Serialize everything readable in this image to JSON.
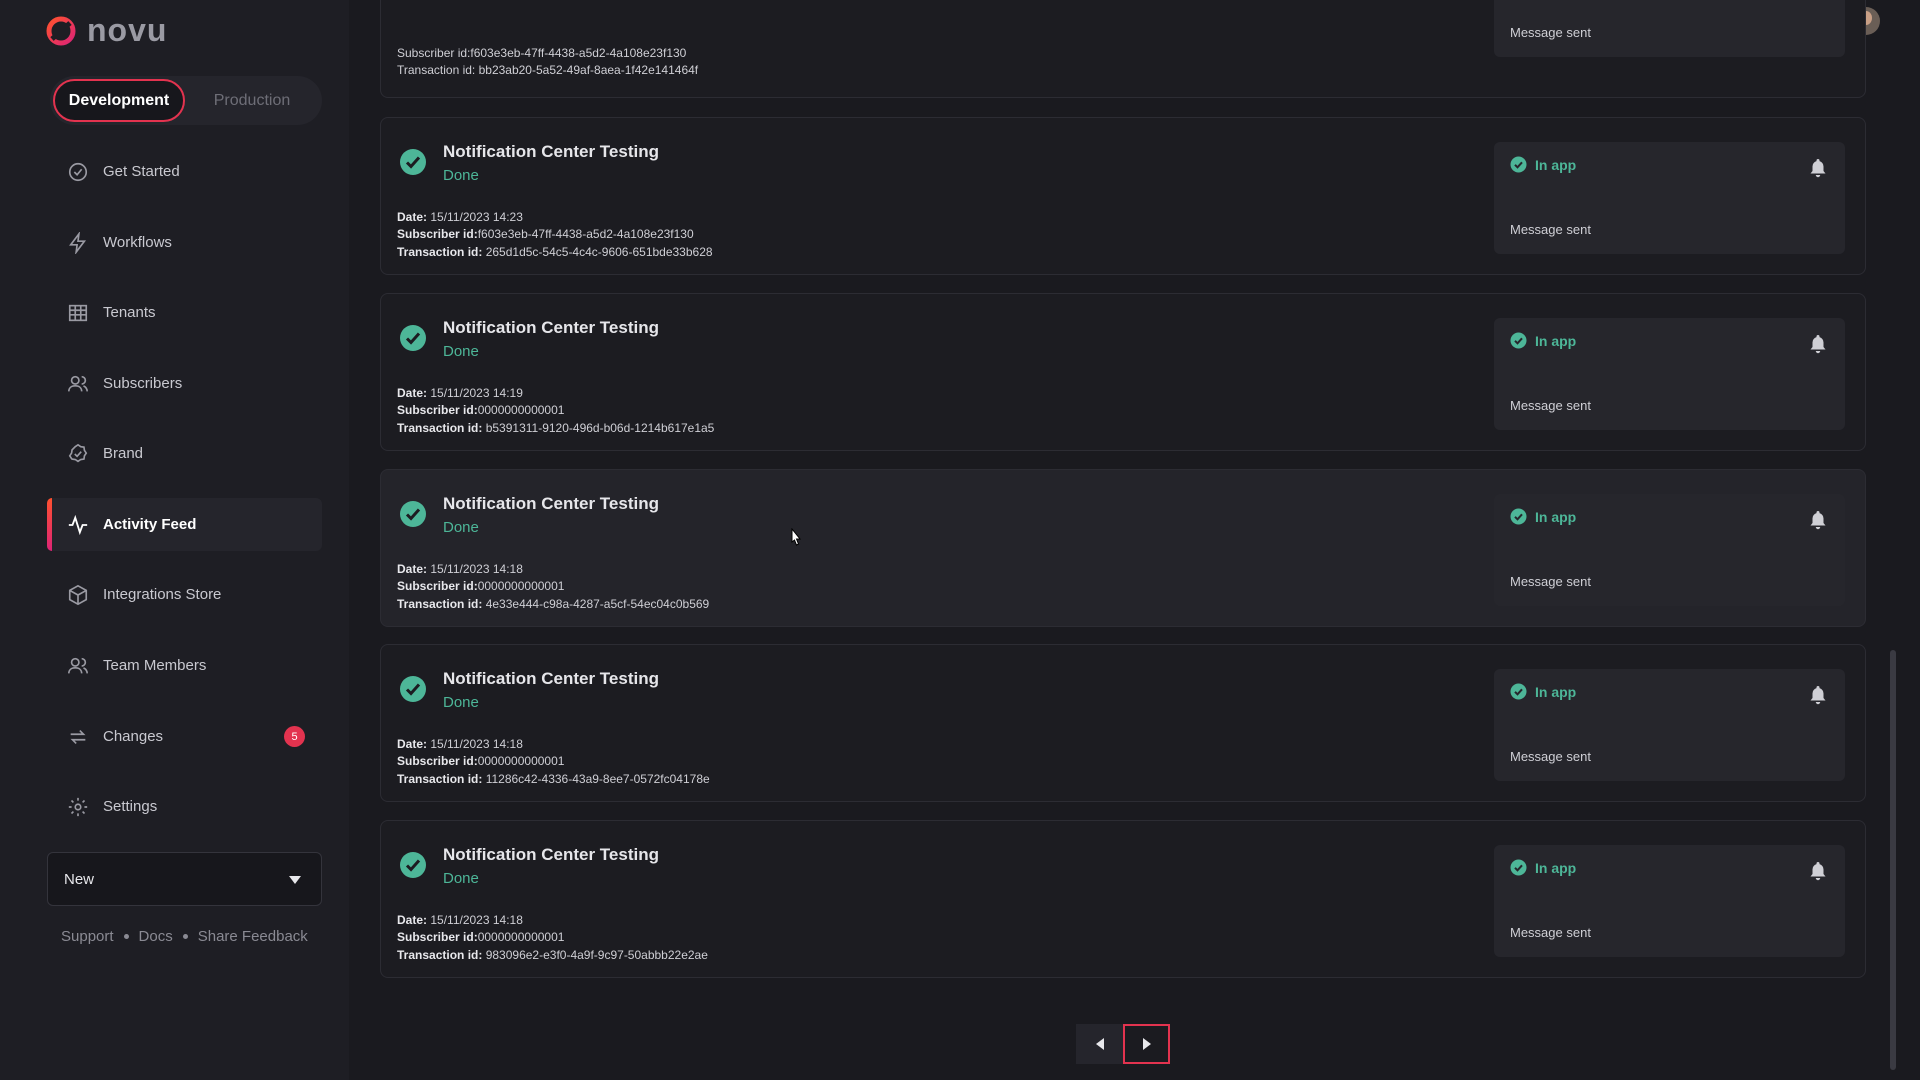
{
  "app": {
    "name": "novu"
  },
  "environment": {
    "development": "Development",
    "production": "Production"
  },
  "sidebar": {
    "items": [
      {
        "label": "Get Started",
        "icon": "check-circle-icon"
      },
      {
        "label": "Workflows",
        "icon": "bolt-icon"
      },
      {
        "label": "Tenants",
        "icon": "building-icon"
      },
      {
        "label": "Subscribers",
        "icon": "users-icon"
      },
      {
        "label": "Brand",
        "icon": "badge-check-icon"
      },
      {
        "label": "Activity Feed",
        "icon": "activity-icon",
        "active": true
      },
      {
        "label": "Integrations Store",
        "icon": "box-icon"
      },
      {
        "label": "Team Members",
        "icon": "team-icon"
      },
      {
        "label": "Changes",
        "icon": "sync-icon",
        "badge": "5"
      },
      {
        "label": "Settings",
        "icon": "gear-icon"
      }
    ],
    "select": {
      "value": "New"
    },
    "footer": {
      "support": "Support",
      "docs": "Docs",
      "feedback": "Share Feedback"
    }
  },
  "header": {
    "icons": [
      "theme-toggle-icon",
      "help-icon",
      "bell-icon",
      "avatar"
    ]
  },
  "feed": {
    "partial": {
      "subscriber": "Subscriber id:f603e3eb-47ff-4438-a5d2-4a108e23f130",
      "transaction": "Transaction id: bb23ab20-5a52-49af-8aea-1f42e141464f",
      "message": "Message sent"
    },
    "cards": [
      {
        "title": "Notification Center Testing",
        "status": "Done",
        "date_label": "Date:",
        "date": "15/11/2023 14:23",
        "subscriber_label": "Subscriber id:",
        "subscriber": "f603e3eb-47ff-4438-a5d2-4a108e23f130",
        "transaction_label": "Transaction id:",
        "transaction": "265d1d5c-54c5-4c4c-9606-651bde33b628",
        "channel": "In app",
        "message": "Message sent"
      },
      {
        "title": "Notification Center Testing",
        "status": "Done",
        "date_label": "Date:",
        "date": "15/11/2023 14:19",
        "subscriber_label": "Subscriber id:",
        "subscriber": "0000000000001",
        "transaction_label": "Transaction id:",
        "transaction": "b5391311-9120-496d-b06d-1214b617e1a5",
        "channel": "In app",
        "message": "Message sent"
      },
      {
        "title": "Notification Center Testing",
        "status": "Done",
        "date_label": "Date:",
        "date": "15/11/2023 14:18",
        "subscriber_label": "Subscriber id:",
        "subscriber": "0000000000001",
        "transaction_label": "Transaction id:",
        "transaction": "4e33e444-c98a-4287-a5cf-54ec04c0b569",
        "channel": "In app",
        "message": "Message sent"
      },
      {
        "title": "Notification Center Testing",
        "status": "Done",
        "date_label": "Date:",
        "date": "15/11/2023 14:18",
        "subscriber_label": "Subscriber id:",
        "subscriber": "0000000000001",
        "transaction_label": "Transaction id:",
        "transaction": "11286c42-4336-43a9-8ee7-0572fc04178e",
        "channel": "In app",
        "message": "Message sent"
      },
      {
        "title": "Notification Center Testing",
        "status": "Done",
        "date_label": "Date:",
        "date": "15/11/2023 14:18",
        "subscriber_label": "Subscriber id:",
        "subscriber": "0000000000001",
        "transaction_label": "Transaction id:",
        "transaction": "983096e2-e3f0-4a9f-9c97-50abbb22e2ae",
        "channel": "In app",
        "message": "Message sent"
      }
    ]
  },
  "colors": {
    "accent": "#e3334f",
    "success": "#4db698",
    "background": "#1a1a1f"
  }
}
